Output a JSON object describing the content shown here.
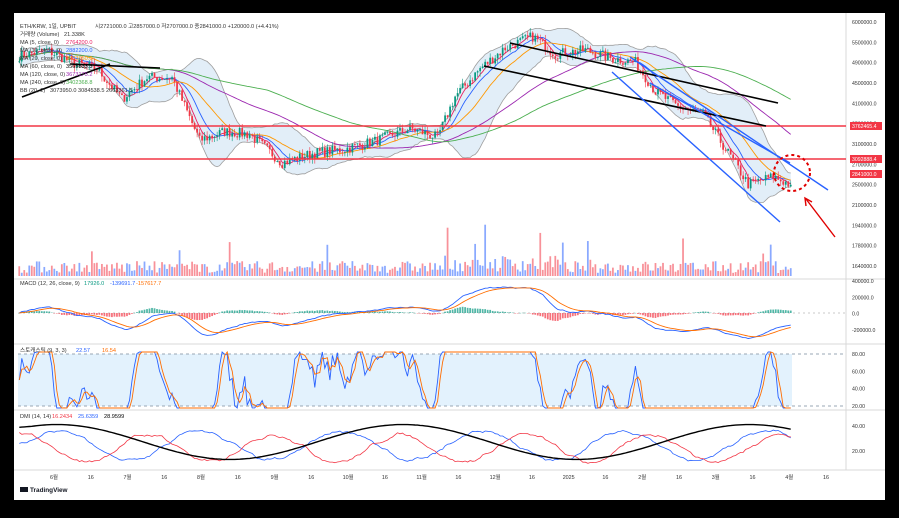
{
  "colors": {
    "frame": "#000000",
    "background": "#ffffff",
    "up": "#089981",
    "down": "#f23645",
    "ma5": "#e91e63",
    "ma10": "#2962ff",
    "ma20": "#ff9800",
    "ma60": "#000000",
    "ma120": "#9c27b0",
    "ma240": "#4caf50",
    "bollinger": "#9e9e9e",
    "bollinger_fill": "#cfe2f3",
    "resistance": "#f23645",
    "channel": "#2962ff",
    "trendline": "#000000",
    "annotation": "#e00000",
    "macd_line": "#2962ff",
    "signal_line": "#ff6d00",
    "stoch_k": "#2962ff",
    "stoch_d": "#ff6d00",
    "stoch_band": "#e3f2fd",
    "dmi_adx": "#000000",
    "dmi_plus": "#2962ff",
    "dmi_minus": "#f23645"
  },
  "header": {
    "symbol_line": "ETH/KRW, 1일, UPBIT",
    "ohlc_line": "시2721000.0  고2857000.0  저2707000.0  종2841000.0  +120000.0 (+4.41%)",
    "volume_label": "거래량 (Volume)",
    "volume_value": "21.338K",
    "ma_rows": [
      {
        "label": "MA (5, close, 0)",
        "value": "2764200.0"
      },
      {
        "label": "MA (10, close, 0)",
        "value": "2882200.0"
      },
      {
        "label": "MA (20, close, 0)",
        "value": "3073950.0"
      },
      {
        "label": "MA (60, close, 0)",
        "value": "3565833.3"
      },
      {
        "label": "MA (120, close, 0)",
        "value": "3673175.2"
      },
      {
        "label": "MA (240, close, 0)",
        "value": "3402368.8"
      }
    ],
    "bb_row": {
      "label": "BB (20, 2)",
      "value": "3073950.0  3084538.5  2663361.5"
    }
  },
  "price_axis": {
    "ticks": [
      "6000000.0",
      "5500000.0",
      "4900000.0",
      "4500000.0",
      "4100000.0",
      "3500000.0",
      "3100000.0",
      "2700000.0",
      "2500000.0",
      "2100000.0",
      "1940000.0",
      "1780000.0",
      "1640000.0"
    ],
    "tags": [
      {
        "name": "resistance-upper-tag",
        "label": "3762465.4",
        "color": "#f23645"
      },
      {
        "name": "resistance-lower-tag",
        "label": "3092888.4",
        "color": "#f23645"
      },
      {
        "name": "last-price-tag",
        "label": "2841000.0",
        "color": "#f23645"
      }
    ]
  },
  "macd": {
    "label": "MACD (12, 26, close, 9)",
    "values": [
      "17926.0",
      "-139691.7",
      "-157617.7"
    ],
    "ticks": [
      "400000.0",
      "200000.0",
      "0.0",
      "-200000.0"
    ]
  },
  "stoch": {
    "label": "스토캐스틱 (9, 3, 3)",
    "values": [
      "22.57",
      "16.54"
    ],
    "ticks": [
      "80.00",
      "60.00",
      "40.00",
      "20.00"
    ]
  },
  "dmi": {
    "label": "DMI (14, 14)",
    "values": [
      "16.2434",
      "25.6359",
      "28.9599"
    ],
    "ticks": [
      "40.00",
      "20.00"
    ]
  },
  "time_axis": [
    "6월",
    "16",
    "7월",
    "16",
    "8월",
    "16",
    "9월",
    "16",
    "10월",
    "16",
    "11월",
    "16",
    "12월",
    "16",
    "2025",
    "16",
    "2월",
    "16",
    "3월",
    "16",
    "4월",
    "16"
  ],
  "brand": "TradingView",
  "chart_data": {
    "type": "candlestick",
    "symbol": "ETH/KRW",
    "interval": "1일",
    "exchange": "UPBIT",
    "last": {
      "open": 2721000,
      "high": 2857000,
      "low": 2707000,
      "close": 2841000,
      "change": 120000,
      "change_pct": 4.41
    },
    "close_series": [
      {
        "date": "2024-05-25",
        "close": 5200000
      },
      {
        "date": "2024-06-05",
        "close": 5350000
      },
      {
        "date": "2024-06-15",
        "close": 5050000
      },
      {
        "date": "2024-06-25",
        "close": 4900000
      },
      {
        "date": "2024-07-05",
        "close": 4250000
      },
      {
        "date": "2024-07-15",
        "close": 4700000
      },
      {
        "date": "2024-07-25",
        "close": 4700000
      },
      {
        "date": "2024-08-05",
        "close": 3500000
      },
      {
        "date": "2024-08-15",
        "close": 3650000
      },
      {
        "date": "2024-08-25",
        "close": 3600000
      },
      {
        "date": "2024-09-07",
        "close": 3150000
      },
      {
        "date": "2024-09-20",
        "close": 3300000
      },
      {
        "date": "2024-10-01",
        "close": 3350000
      },
      {
        "date": "2024-10-15",
        "close": 3500000
      },
      {
        "date": "2024-10-28",
        "close": 3700000
      },
      {
        "date": "2024-11-08",
        "close": 3550000
      },
      {
        "date": "2024-11-15",
        "close": 4300000
      },
      {
        "date": "2024-11-25",
        "close": 4900000
      },
      {
        "date": "2024-12-05",
        "close": 5400000
      },
      {
        "date": "2024-12-16",
        "close": 5700000
      },
      {
        "date": "2024-12-25",
        "close": 5250000
      },
      {
        "date": "2025-01-06",
        "close": 5350000
      },
      {
        "date": "2025-01-16",
        "close": 5150000
      },
      {
        "date": "2025-01-26",
        "close": 5050000
      },
      {
        "date": "2025-02-03",
        "close": 4400000
      },
      {
        "date": "2025-02-12",
        "close": 4100000
      },
      {
        "date": "2025-02-22",
        "close": 3950000
      },
      {
        "date": "2025-03-04",
        "close": 3300000
      },
      {
        "date": "2025-03-12",
        "close": 2850000
      },
      {
        "date": "2025-03-22",
        "close": 2950000
      },
      {
        "date": "2025-03-29",
        "close": 2841000
      }
    ],
    "horizontal_lines": [
      3762465.4,
      3092888.4
    ],
    "volume_label": "거래량",
    "panes": [
      "price",
      "volume",
      "MACD",
      "Stochastic",
      "DMI"
    ],
    "legend_placement": "top-left",
    "grid": false
  }
}
